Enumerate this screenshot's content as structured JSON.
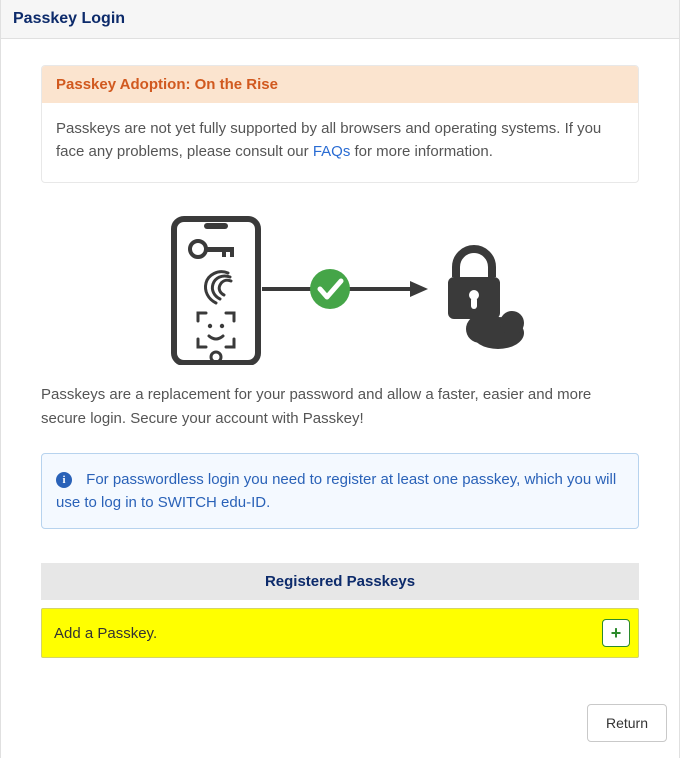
{
  "header": {
    "title": "Passkey Login"
  },
  "alert": {
    "title": "Passkey Adoption: On the Rise",
    "body_before_link": "Passkeys are not yet fully supported by all browsers and operating systems. If you face any problems, please consult our ",
    "link_label": "FAQs",
    "body_after_link": " for more information."
  },
  "description": "Passkeys are a replacement for your password and allow a faster, easier and more secure login. Secure your account with Passkey!",
  "info": {
    "text": "For passwordless login you need to register at least one passkey, which you will use to log in to SWITCH edu-ID."
  },
  "section": {
    "title": "Registered Passkeys"
  },
  "add_row": {
    "label": "Add a Passkey."
  },
  "footer": {
    "return_label": "Return"
  }
}
